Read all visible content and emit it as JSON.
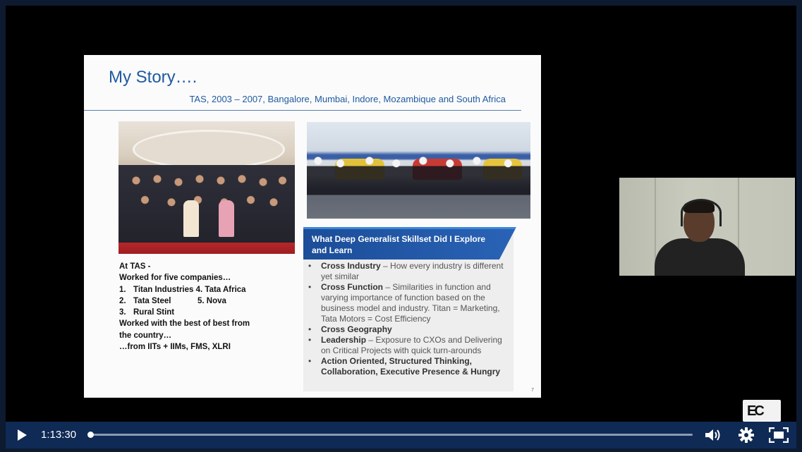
{
  "slide": {
    "title": "My Story….",
    "subtitle": "TAS, 2003 – 2007, Bangalore, Mumbai, Indore, Mozambique and South Africa",
    "tas": {
      "heading": "At TAS -",
      "line1": "Worked for five companies…",
      "row1_num": "1.",
      "row1_text": "Titan Industries 4. Tata Africa",
      "row2_num": "2.",
      "row2_text": "Tata Steel",
      "row2_extra": "5. Nova",
      "row3_num": "3.",
      "row3_text": "Rural Stint",
      "line2": "Worked with the best of best from",
      "line3": "the country…",
      "line4": "…from IITs + IIMs, FMS, XLRI"
    },
    "skills": {
      "header": "What Deep Generalist Skillset Did I Explore and Learn",
      "items": [
        {
          "bold": "Cross Industry",
          "rest": " – How every industry is different yet similar"
        },
        {
          "bold": "Cross Function",
          "rest": " – Similarities in function and varying importance of function based on the business model and industry. Titan = Marketing, Tata Motors = Cost Efficiency"
        },
        {
          "bold": "Cross Geography",
          "rest": ""
        },
        {
          "bold": "Leadership",
          "rest": " – Exposure to CXOs and Delivering on Critical Projects with quick turn-arounds"
        },
        {
          "bold": "Action Oriented, Structured Thinking, Collaboration, Executive Presence & Hungry",
          "rest": ""
        }
      ]
    },
    "page_number": "7"
  },
  "controls": {
    "time": "1:13:30",
    "progress": 0.0,
    "icons": {
      "play": "play-icon",
      "volume": "volume-icon",
      "settings": "gear-icon",
      "fullscreen": "fullscreen-icon"
    }
  },
  "logo": {
    "text": "EC"
  },
  "colors": {
    "player_bg": "#0d1a30",
    "controls_bg": "#0f2a55",
    "slide_title": "#1f5aa0",
    "skill_header": "#1b4d98"
  }
}
